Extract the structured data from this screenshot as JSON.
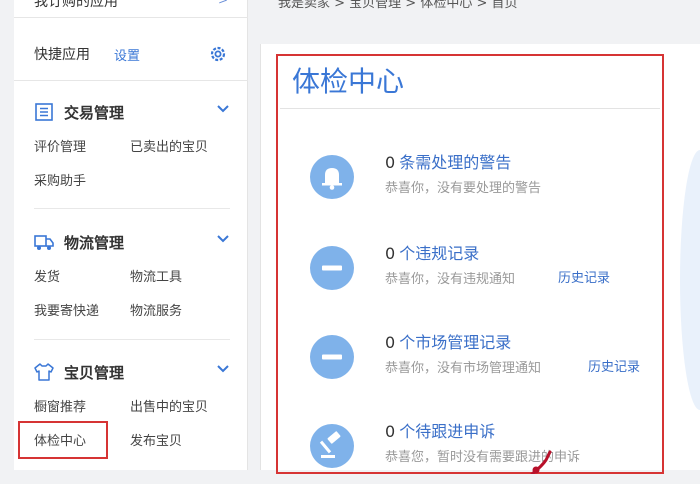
{
  "sidebar": {
    "top_item": "我订购的应用",
    "quick": {
      "title": "快捷应用",
      "settings": "设置"
    },
    "sections": [
      {
        "title": "交易管理",
        "links": [
          "评价管理",
          "已卖出的宝贝",
          "采购助手"
        ]
      },
      {
        "title": "物流管理",
        "links": [
          "发货",
          "物流工具",
          "我要寄快递",
          "物流服务"
        ]
      },
      {
        "title": "宝贝管理",
        "links": [
          "橱窗推荐",
          "出售中的宝贝",
          "体检中心",
          "发布宝贝"
        ]
      }
    ]
  },
  "breadcrumb": "我是卖家 > 宝贝管理 > 体检中心 > 首页",
  "main": {
    "title": "体检中心",
    "items": [
      {
        "count": "0",
        "label": "条需处理的警告",
        "desc": "恭喜你，没有要处理的警告",
        "icon": "bell-icon"
      },
      {
        "count": "0",
        "label": "个违规记录",
        "desc": "恭喜你，没有违规通知",
        "history": "历史记录",
        "icon": "minus-icon"
      },
      {
        "count": "0",
        "label": "个市场管理记录",
        "desc": "恭喜你，没有市场管理通知",
        "history": "历史记录",
        "icon": "minus-icon"
      },
      {
        "count": "0",
        "label": "个待跟进申诉",
        "desc": "恭喜您，暂时没有需要跟进的申诉",
        "icon": "gavel-icon"
      }
    ]
  },
  "colors": {
    "accent": "#3a77d6",
    "icon_bg": "#7fb2ea",
    "highlight": "#d63434"
  }
}
